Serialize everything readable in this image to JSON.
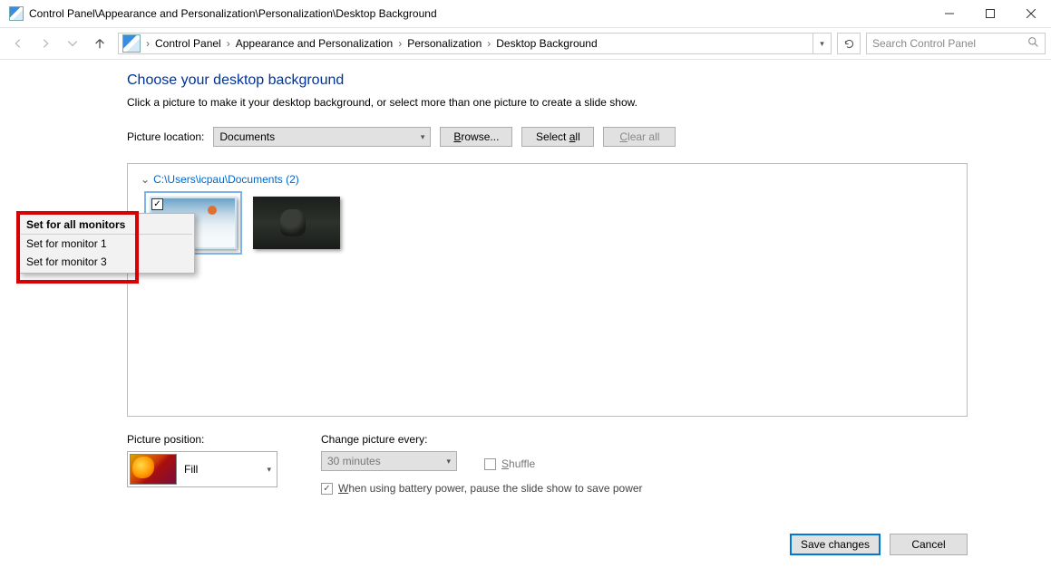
{
  "title_path": "Control Panel\\Appearance and Personalization\\Personalization\\Desktop Background",
  "breadcrumb": [
    "Control Panel",
    "Appearance and Personalization",
    "Personalization",
    "Desktop Background"
  ],
  "search_placeholder": "Search Control Panel",
  "heading": "Choose your desktop background",
  "subtext": "Click a picture to make it your desktop background, or select more than one picture to create a slide show.",
  "picture_location_label": "Picture location:",
  "picture_location_value": "Documents",
  "browse_label": "Browse...",
  "select_all_label": "Select all",
  "clear_all_label": "Clear all",
  "group_header": "C:\\Users\\icpau\\Documents (2)",
  "context_menu": {
    "header": "Set for all monitors",
    "items": [
      "Set for monitor 1",
      "Set for monitor 3"
    ]
  },
  "picture_position_label": "Picture position:",
  "picture_position_value": "Fill",
  "change_every_label": "Change picture every:",
  "change_every_value": "30 minutes",
  "shuffle_label": "Shuffle",
  "battery_label": "When using battery power, pause the slide show to save power",
  "save_label": "Save changes",
  "cancel_label": "Cancel"
}
